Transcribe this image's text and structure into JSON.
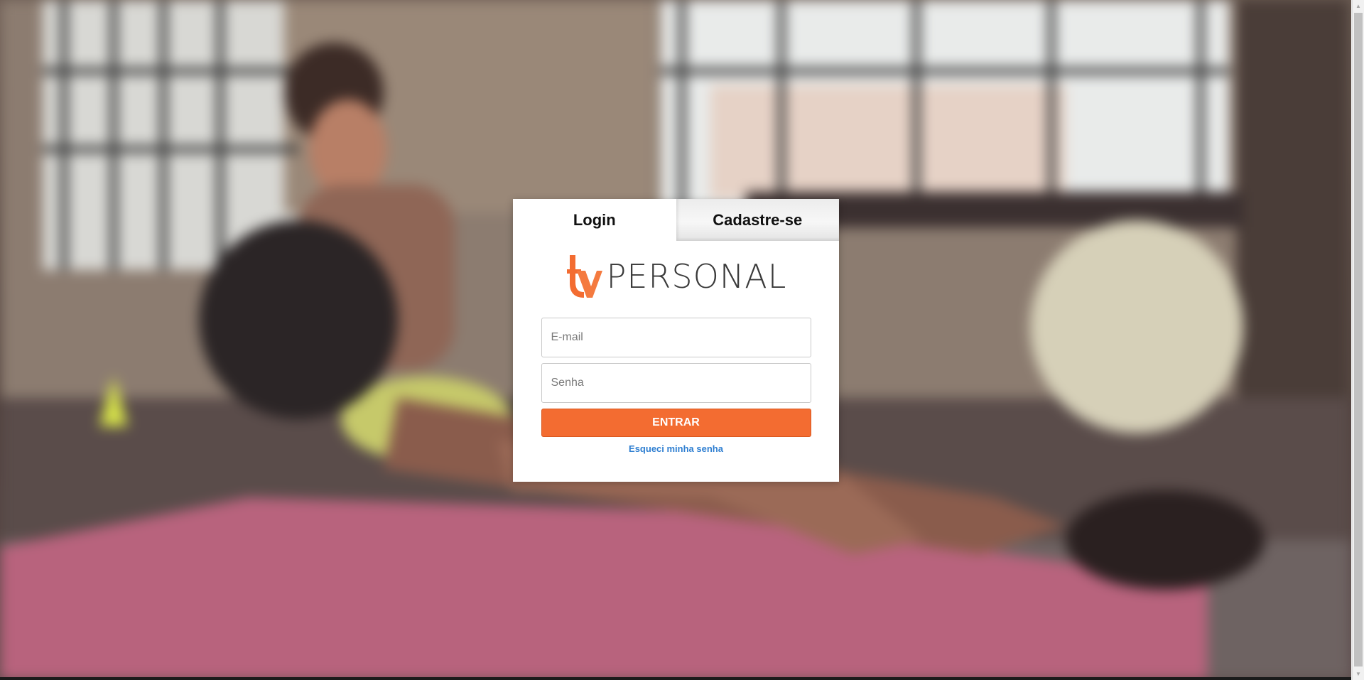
{
  "tabs": {
    "login": "Login",
    "signup": "Cadastre-se"
  },
  "logo": {
    "text": "PERSONAL",
    "accent_color": "#f36c31"
  },
  "form": {
    "email_placeholder": "E-mail",
    "email_value": "",
    "password_placeholder": "Senha",
    "password_value": "",
    "submit_label": "ENTRAR",
    "forgot_label": "Esqueci minha senha"
  },
  "colors": {
    "primary": "#f36c31",
    "link": "#2f7fd1"
  },
  "background": {
    "description_icon": "fitness-photo-background"
  },
  "scrollbar": {
    "up_icon": "▲",
    "down_icon": "▼"
  }
}
